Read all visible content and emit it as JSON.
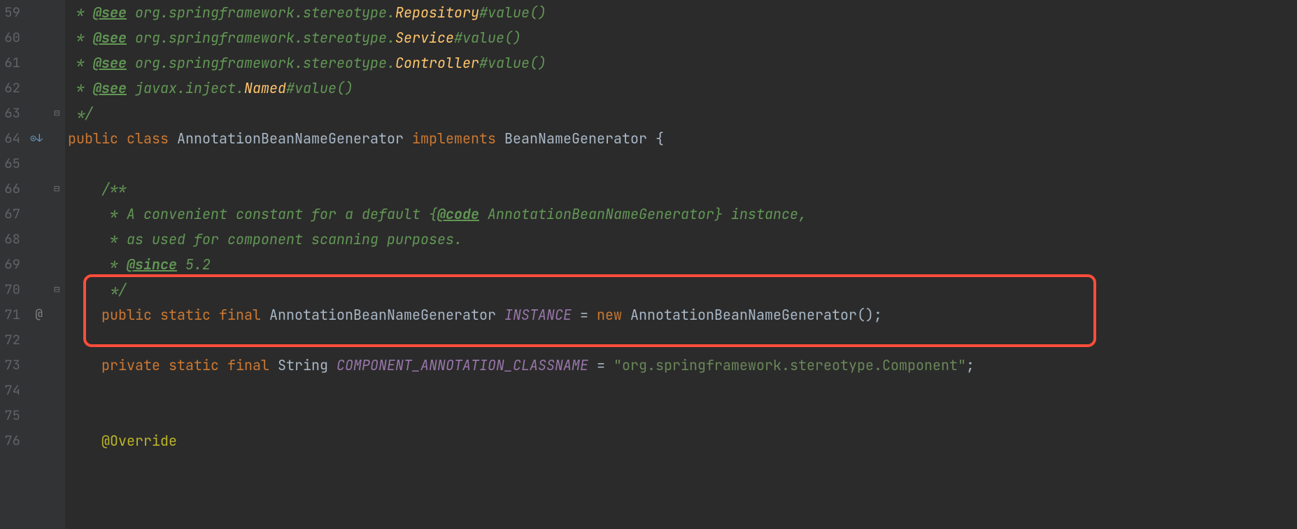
{
  "gutter": {
    "start": 59,
    "end": 76,
    "icons": {
      "64": "impl",
      "71": "at"
    }
  },
  "fold": {
    "63": "⊟",
    "66": "⊟",
    "70": "⊟"
  },
  "lines": {
    "59": {
      "indent": " ",
      "tokens": [
        {
          "t": "* ",
          "c": "doc-comment"
        },
        {
          "t": "@see",
          "c": "doc-tag"
        },
        {
          "t": " org.springframework.stereotype.",
          "c": "doc-comment"
        },
        {
          "t": "Repository",
          "c": "type-yellow"
        },
        {
          "t": "#value()",
          "c": "doc-comment"
        }
      ]
    },
    "60": {
      "indent": " ",
      "tokens": [
        {
          "t": "* ",
          "c": "doc-comment"
        },
        {
          "t": "@see",
          "c": "doc-tag"
        },
        {
          "t": " org.springframework.stereotype.",
          "c": "doc-comment"
        },
        {
          "t": "Service",
          "c": "type-yellow"
        },
        {
          "t": "#value()",
          "c": "doc-comment"
        }
      ]
    },
    "61": {
      "indent": " ",
      "tokens": [
        {
          "t": "* ",
          "c": "doc-comment"
        },
        {
          "t": "@see",
          "c": "doc-tag"
        },
        {
          "t": " org.springframework.stereotype.",
          "c": "doc-comment"
        },
        {
          "t": "Controller",
          "c": "type-yellow"
        },
        {
          "t": "#value()",
          "c": "doc-comment"
        }
      ]
    },
    "62": {
      "indent": " ",
      "tokens": [
        {
          "t": "* ",
          "c": "doc-comment"
        },
        {
          "t": "@see",
          "c": "doc-tag"
        },
        {
          "t": " javax.inject.",
          "c": "doc-comment"
        },
        {
          "t": "Named",
          "c": "type-yellow"
        },
        {
          "t": "#value()",
          "c": "doc-comment"
        }
      ]
    },
    "63": {
      "indent": " ",
      "tokens": [
        {
          "t": "*/",
          "c": "doc-comment"
        }
      ]
    },
    "64": {
      "indent": "",
      "tokens": [
        {
          "t": "public class ",
          "c": "keyword"
        },
        {
          "t": "AnnotationBeanNameGenerator ",
          "c": "classname"
        },
        {
          "t": "implements ",
          "c": "keyword"
        },
        {
          "t": "BeanNameGenerator {",
          "c": "classname"
        }
      ]
    },
    "65": {
      "indent": "",
      "tokens": []
    },
    "66": {
      "indent": "    ",
      "tokens": [
        {
          "t": "/**",
          "c": "doc-comment"
        }
      ]
    },
    "67": {
      "indent": "    ",
      "tokens": [
        {
          "t": " * A convenient constant for a default {",
          "c": "doc-comment"
        },
        {
          "t": "@code",
          "c": "doc-tag"
        },
        {
          "t": " AnnotationBeanNameGenerator} instance,",
          "c": "doc-comment"
        }
      ]
    },
    "68": {
      "indent": "    ",
      "tokens": [
        {
          "t": " * as used for component scanning purposes.",
          "c": "doc-comment"
        }
      ]
    },
    "69": {
      "indent": "    ",
      "tokens": [
        {
          "t": " * ",
          "c": "doc-comment"
        },
        {
          "t": "@since",
          "c": "doc-tag"
        },
        {
          "t": " 5.2",
          "c": "doc-comment"
        }
      ]
    },
    "70": {
      "indent": "    ",
      "tokens": [
        {
          "t": " */",
          "c": "doc-comment"
        }
      ]
    },
    "71": {
      "indent": "    ",
      "tokens": [
        {
          "t": "public static final ",
          "c": "keyword"
        },
        {
          "t": "AnnotationBeanNameGenerator ",
          "c": "classname"
        },
        {
          "t": "INSTANCE",
          "c": "static-field"
        },
        {
          "t": " = ",
          "c": "classname"
        },
        {
          "t": "new ",
          "c": "keyword"
        },
        {
          "t": "AnnotationBeanNameGenerator();",
          "c": "classname"
        }
      ]
    },
    "72": {
      "indent": "",
      "tokens": []
    },
    "73": {
      "indent": "    ",
      "tokens": [
        {
          "t": "private static final ",
          "c": "keyword"
        },
        {
          "t": "String ",
          "c": "classname"
        },
        {
          "t": "COMPONENT_ANNOTATION_CLASSNAME",
          "c": "static-field"
        },
        {
          "t": " = ",
          "c": "classname"
        },
        {
          "t": "\"org.springframework.stereotype.Component\"",
          "c": "string"
        },
        {
          "t": ";",
          "c": "classname"
        }
      ]
    },
    "74": {
      "indent": "",
      "tokens": []
    },
    "75": {
      "indent": "",
      "tokens": []
    },
    "76": {
      "indent": "    ",
      "tokens": [
        {
          "t": "@Override",
          "c": "annotation"
        }
      ]
    }
  }
}
